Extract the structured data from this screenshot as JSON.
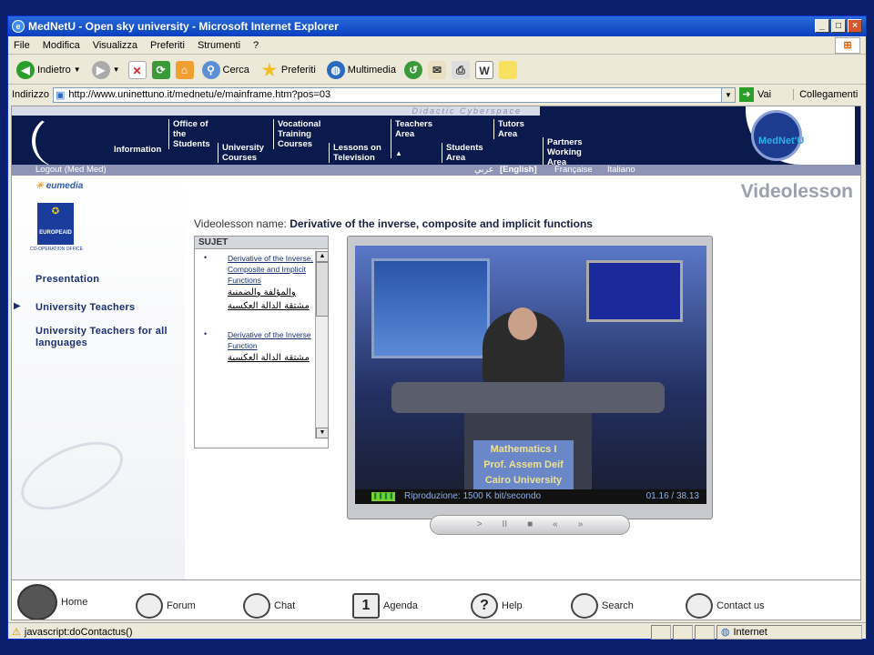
{
  "window": {
    "title": "MedNetU - Open sky university - Microsoft Internet Explorer",
    "controls": [
      "_",
      "□",
      "×"
    ]
  },
  "menu": [
    "File",
    "Modifica",
    "Visualizza",
    "Preferiti",
    "Strumenti",
    "?"
  ],
  "toolbar": {
    "back": "Indietro",
    "search": "Cerca",
    "favorites": "Preferiti",
    "media": "Multimedia"
  },
  "address": {
    "label": "Indirizzo",
    "url": "http://www.uninettuno.it/mednetu/e/mainframe.htm?pos=03",
    "go": "Vai",
    "links": "Collegamenti"
  },
  "site": {
    "strip": "Didactic Cyberspace",
    "nav": [
      "Information",
      "Office of the Students",
      "University Courses",
      "Vocational Training Courses",
      "Lessons on Television",
      "Teachers Area",
      "Students Area",
      "Tutors Area",
      "Partners Working Area"
    ],
    "logo": "MedNet'U",
    "logout": "Logout (Med Med)",
    "languages": [
      "عربي",
      "[English]",
      "Française",
      "Italiano"
    ],
    "sidebar": {
      "eumedia": "eumedia",
      "europeaid": "EUROPEAID",
      "europeaid_sub": "CO-OPERATION OFFICE",
      "items": [
        "Presentation",
        "University Teachers",
        "University Teachers for all languages"
      ]
    },
    "page_title": "Videolesson",
    "lesson_label": "Videolesson name:",
    "lesson_name": "Derivative of the inverse, composite and implicit functions",
    "sujet": {
      "header": "SUJET",
      "items": [
        {
          "en": "Derivative of the Inverse, Composite and Implicit Functions",
          "ar": "والمؤلفة والضمنية مشتقة الدالة العكسية"
        },
        {
          "en": "Derivative of the Inverse Function",
          "ar": "مشتقة الدالة العكسية"
        }
      ]
    },
    "player": {
      "desk_line1": "Mathematics I",
      "desk_line2": "Prof. Assem Deif",
      "desk_line3": "Cairo University",
      "status": "Riproduzione: 1500 K bit/secondo",
      "time": "01.16 / 38.13",
      "controls": [
        ">",
        "II",
        "■",
        "«",
        "»"
      ]
    },
    "bottom": [
      "Home",
      "Forum",
      "Chat",
      "Agenda",
      "Help",
      "Search",
      "Contact us"
    ]
  },
  "statusbar": {
    "text": "javascript:doContactus()",
    "zone": "Internet"
  }
}
